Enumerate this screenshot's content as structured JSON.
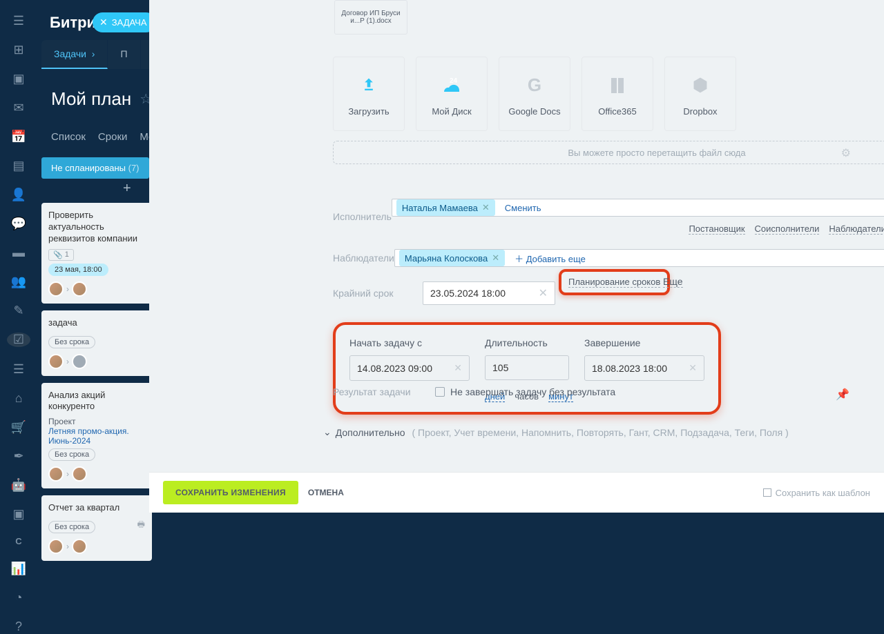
{
  "brand": "Битрик",
  "badge": "ЗАДАЧА",
  "tabs": {
    "active": "Задачи",
    "next": "П"
  },
  "page_title": "Мой план",
  "subtabs": [
    "Список",
    "Сроки",
    "Мо"
  ],
  "filter": {
    "label": "Не спланированы",
    "count": "(7)"
  },
  "cards": [
    {
      "title": "Проверить актуальность реквизитов компании",
      "count": "1",
      "chip": "23 мая, 18:00",
      "chip_blue": true
    },
    {
      "title": "задача",
      "chip": "Без срока"
    },
    {
      "title": "Анализ акций конкуренто",
      "sub": "Проект",
      "link": "Летняя промо-акция. Июнь-2024",
      "chip": "Без срока"
    },
    {
      "title": "Отчет за квартал",
      "chip": "Без срока"
    }
  ],
  "doc_name": "Договор ИП Бруси и...Р (1).docx",
  "upload_tiles": [
    "Загрузить",
    "Мой Диск",
    "Google Docs",
    "Office365",
    "Dropbox"
  ],
  "dropzone": "Вы можете просто перетащить файл сюда",
  "labels": {
    "assignee": "Исполнитель",
    "watchers": "Наблюдатели",
    "deadline": "Крайний срок",
    "result": "Результат задачи",
    "extra": "Дополнительно"
  },
  "assignee": {
    "name": "Наталья Мамаева",
    "change": "Сменить"
  },
  "roles": [
    "Постановщик",
    "Соисполнители",
    "Наблюдатели"
  ],
  "watcher": {
    "name": "Марьяна Колоскова",
    "add": "Добавить еще"
  },
  "deadline_value": "23.05.2024 18:00",
  "planning_link": "Планирование сроков",
  "more": "Еще",
  "planning": {
    "start_label": "Начать задачу с",
    "start": "14.08.2023 09:00",
    "duration_label": "Длительность",
    "duration": "105",
    "end_label": "Завершение",
    "end": "18.08.2023 18:00",
    "units": [
      "дней",
      "часов",
      "минут"
    ]
  },
  "result_checkbox": "Не завершать задачу без результата",
  "extra_list": "( Проект,  Учет времени,  Напомнить,  Повторять,  Гант,  CRM,  Подзадача,  Теги,  Поля )",
  "footer": {
    "save": "СОХРАНИТЬ ИЗМЕНЕНИЯ",
    "cancel": "ОТМЕНА",
    "template": "Сохранить как шаблон"
  },
  "cloud_badge": "24"
}
